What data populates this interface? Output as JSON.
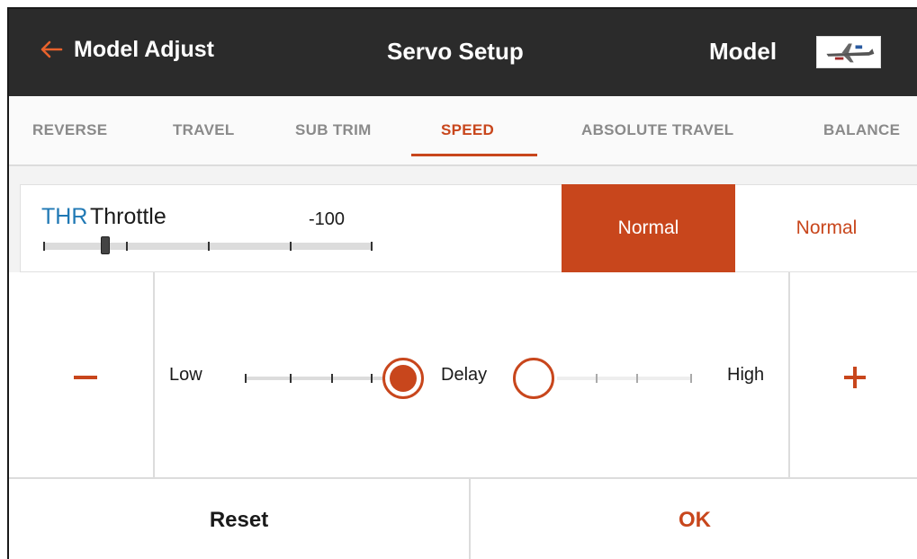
{
  "header": {
    "back_label": "Model Adjust",
    "title": "Servo Setup",
    "model_label": "Model",
    "model_image": "model-thumbnail"
  },
  "tabs": [
    {
      "label": "REVERSE"
    },
    {
      "label": "TRAVEL"
    },
    {
      "label": "SUB TRIM"
    },
    {
      "label": "SPEED",
      "active": true
    },
    {
      "label": "ABSOLUTE TRAVEL"
    },
    {
      "label": "BALANCE"
    }
  ],
  "channel": {
    "abbr": "THR",
    "name": "Throttle",
    "value": "-100",
    "position_fraction": 0.0
  },
  "speed_modes": {
    "left": "Normal",
    "right": "Normal"
  },
  "speed_control": {
    "minus_label": "minus",
    "low_label": "Low",
    "delay_label": "Delay",
    "high_label": "High",
    "plus_label": "plus"
  },
  "actions": {
    "reset_label": "Reset",
    "ok_label": "OK"
  },
  "colors": {
    "accent": "#c8461c",
    "header_bg": "#2b2b2b",
    "channel_abbr": "#1f78b4"
  }
}
